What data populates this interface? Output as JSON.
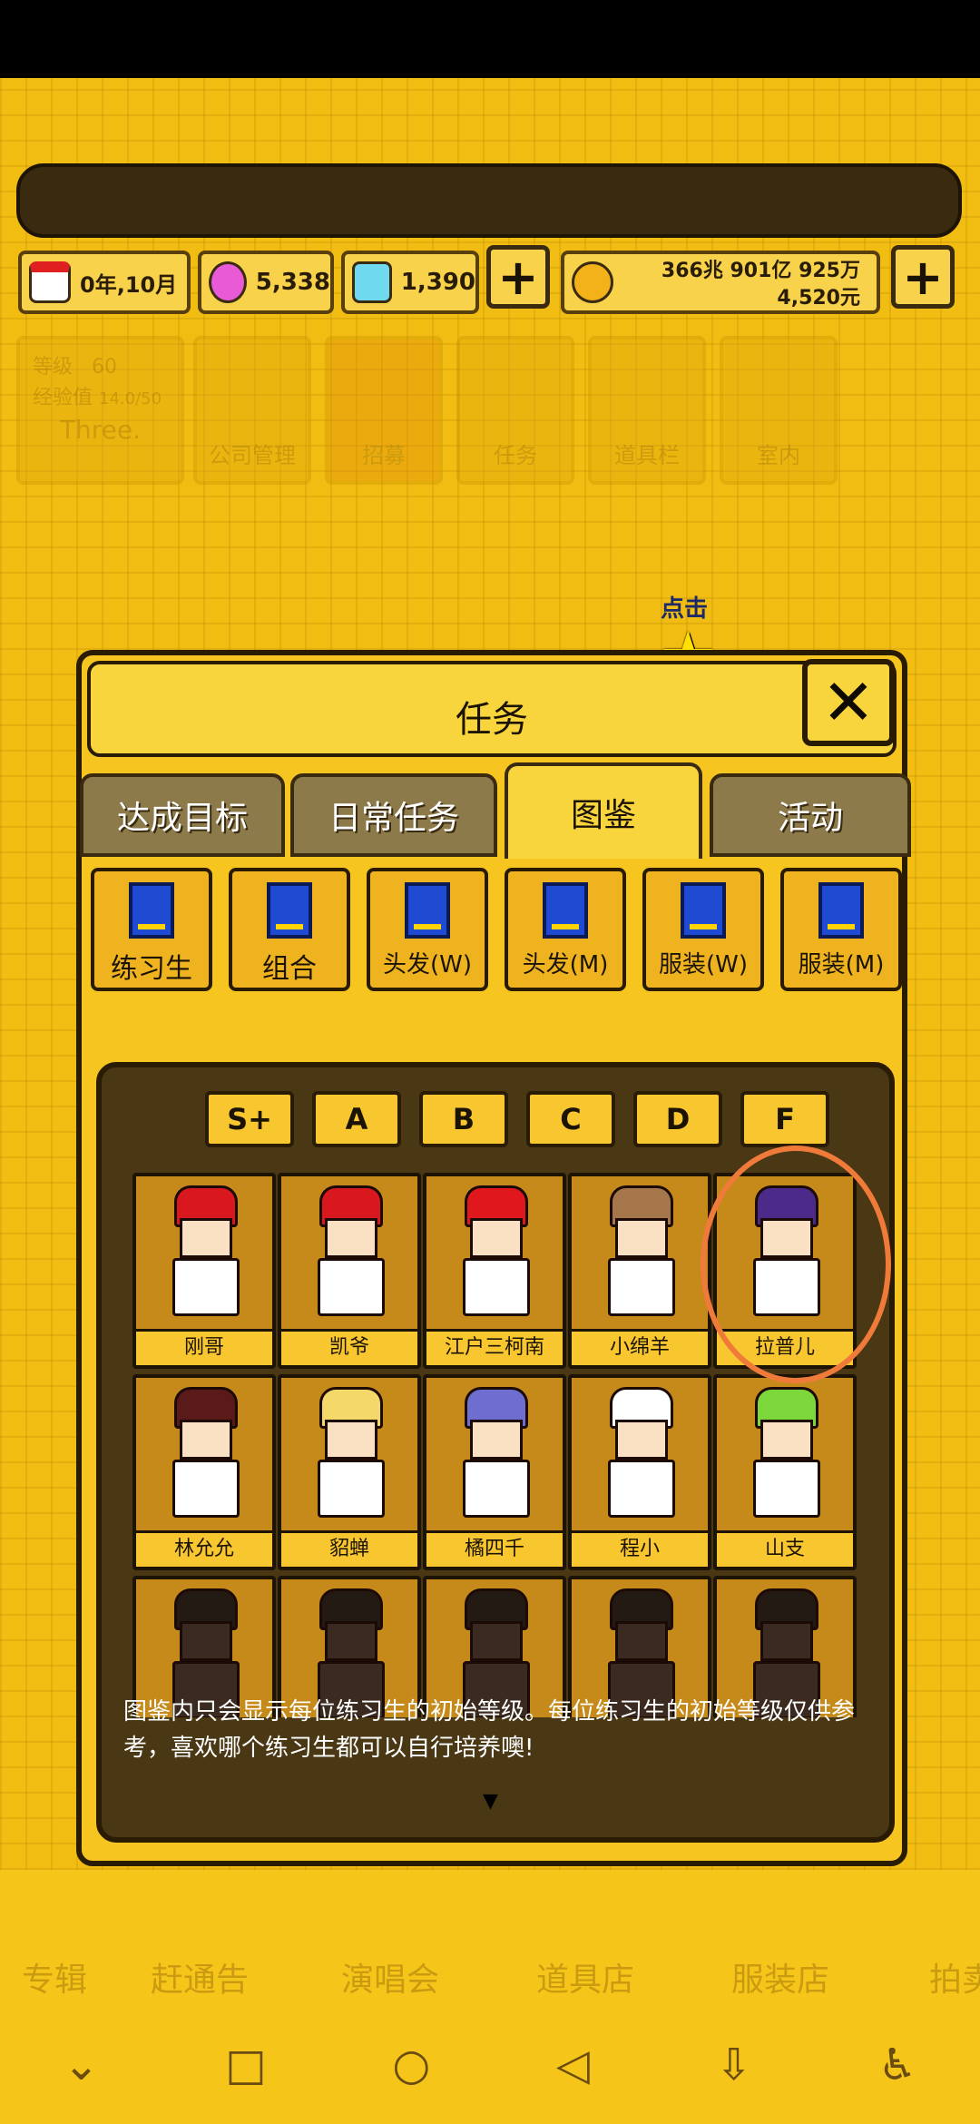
{
  "resources": {
    "date": "0年,10月",
    "pink_gems": "5,338",
    "diamonds": "1,390",
    "money_line1": "366兆 901亿 925万",
    "money_line2": "4,520元"
  },
  "top_menu": {
    "level_label": "等级",
    "level_value": "60",
    "exp_label": "经验值",
    "exp_value": "14.0/50",
    "company": "Three.",
    "tiles": [
      "公司管理",
      "招募",
      "任务",
      "道具栏",
      "室内"
    ]
  },
  "hint": {
    "label": "点击"
  },
  "dialog": {
    "title": "任务",
    "tabs": [
      "达成目标",
      "日常任务",
      "图鉴",
      "活动"
    ],
    "active_tab": "图鉴",
    "categories": [
      "练习生",
      "组合",
      "头发(W)",
      "头发(M)",
      "服装(W)",
      "服装(M)"
    ],
    "grades": [
      "S+",
      "A",
      "B",
      "C",
      "D",
      "F"
    ],
    "characters": [
      {
        "name": "刚哥",
        "hair": "#d8181e"
      },
      {
        "name": "凯爷",
        "hair": "#d8181e"
      },
      {
        "name": "江户三柯南",
        "hair": "#e0181e"
      },
      {
        "name": "小绵羊",
        "hair": "#a5774a"
      },
      {
        "name": "拉普儿",
        "hair": "#4b2a8a"
      },
      {
        "name": "林允允",
        "hair": "#5a1a1a"
      },
      {
        "name": "貂蝉",
        "hair": "#f4d96a"
      },
      {
        "name": "橘四千",
        "hair": "#6d6ed0"
      },
      {
        "name": "程小",
        "hair": "#ffffff"
      },
      {
        "name": "山支",
        "hair": "#7cd83a"
      }
    ],
    "description": "图鉴内只会显示每位练习生的初始等级。每位练习生的初始等级仅供参考，喜欢哪个练习生都可以自行培养噢!"
  },
  "bottom_nav": [
    "专辑",
    "赶通告",
    "演唱会",
    "道具店",
    "服装店",
    "拍卖"
  ]
}
